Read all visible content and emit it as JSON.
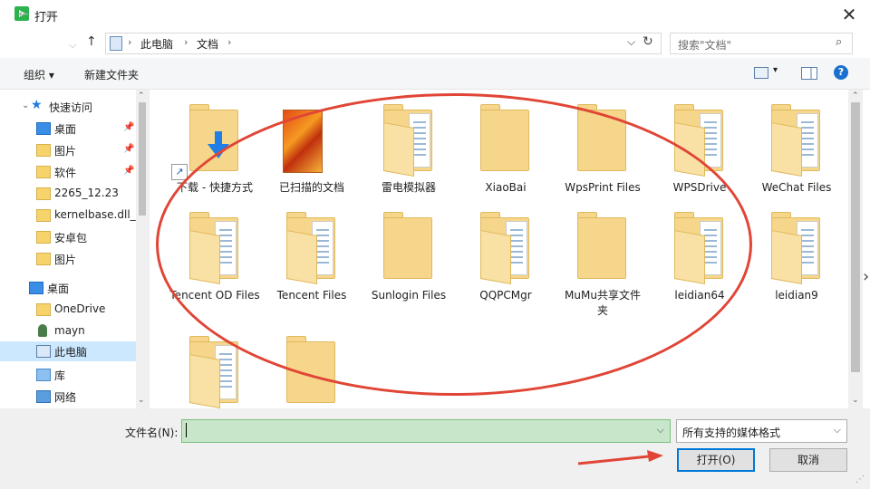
{
  "window": {
    "title": "打开",
    "close": "✕"
  },
  "nav": {
    "back": "←",
    "forward": "→",
    "recent": "⌵",
    "up": "↑"
  },
  "address": {
    "crumbs": [
      "此电脑",
      "文档"
    ],
    "sep": "›",
    "dropdown": "⌵",
    "refresh": "↻"
  },
  "search": {
    "placeholder": "搜索\"文档\"",
    "icon": "⌕"
  },
  "toolbar": {
    "organize": "组织 ▾",
    "new_folder": "新建文件夹",
    "view_dd": "▾",
    "help": "?"
  },
  "sidebar": {
    "items": [
      {
        "label": "快速访问",
        "icon": "star"
      },
      {
        "label": "桌面",
        "icon": "desktop",
        "pinned": true
      },
      {
        "label": "图片",
        "icon": "folder",
        "pinned": true
      },
      {
        "label": "软件",
        "icon": "folder",
        "pinned": true
      },
      {
        "label": "2265_12.23",
        "icon": "folder"
      },
      {
        "label": "kernelbase.dll_2",
        "icon": "folder"
      },
      {
        "label": "安卓包",
        "icon": "folder"
      },
      {
        "label": "图片",
        "icon": "folder"
      },
      {
        "label": "桌面",
        "icon": "desktop"
      },
      {
        "label": "OneDrive",
        "icon": "folder"
      },
      {
        "label": "mayn",
        "icon": "user"
      },
      {
        "label": "此电脑",
        "icon": "pc",
        "selected": true
      },
      {
        "label": "库",
        "icon": "library"
      },
      {
        "label": "网络",
        "icon": "network"
      }
    ],
    "pin_glyph": "📌"
  },
  "files": [
    {
      "label": "下载 - 快捷方式",
      "kind": "shortcut"
    },
    {
      "label": "已扫描的文档",
      "kind": "photo"
    },
    {
      "label": "雷电模拟器",
      "kind": "folder-doc"
    },
    {
      "label": "XiaoBai",
      "kind": "folder"
    },
    {
      "label": "WpsPrint Files",
      "kind": "folder"
    },
    {
      "label": "WPSDrive",
      "kind": "folder-doc"
    },
    {
      "label": "WeChat Files",
      "kind": "folder-doc"
    },
    {
      "label": "Tencent OD Files",
      "kind": "folder-doc"
    },
    {
      "label": "Tencent Files",
      "kind": "folder-doc"
    },
    {
      "label": "Sunlogin Files",
      "kind": "folder"
    },
    {
      "label": "QQPCMgr",
      "kind": "folder-doc"
    },
    {
      "label": "MuMu共享文件夹",
      "kind": "folder"
    },
    {
      "label": "leidian64",
      "kind": "folder-doc"
    },
    {
      "label": "leidian9",
      "kind": "folder-doc"
    },
    {
      "label": "",
      "kind": "folder-doc"
    },
    {
      "label": "",
      "kind": "folder"
    }
  ],
  "footer": {
    "filename_label": "文件名(N):",
    "filename_value": "",
    "filetype": "所有支持的媒体格式",
    "open": "打开(O)",
    "cancel": "取消",
    "dd": "⌵"
  },
  "colors": {
    "annotation": "#e04536",
    "accent": "#0078d7",
    "selected": "#cce8ff"
  }
}
